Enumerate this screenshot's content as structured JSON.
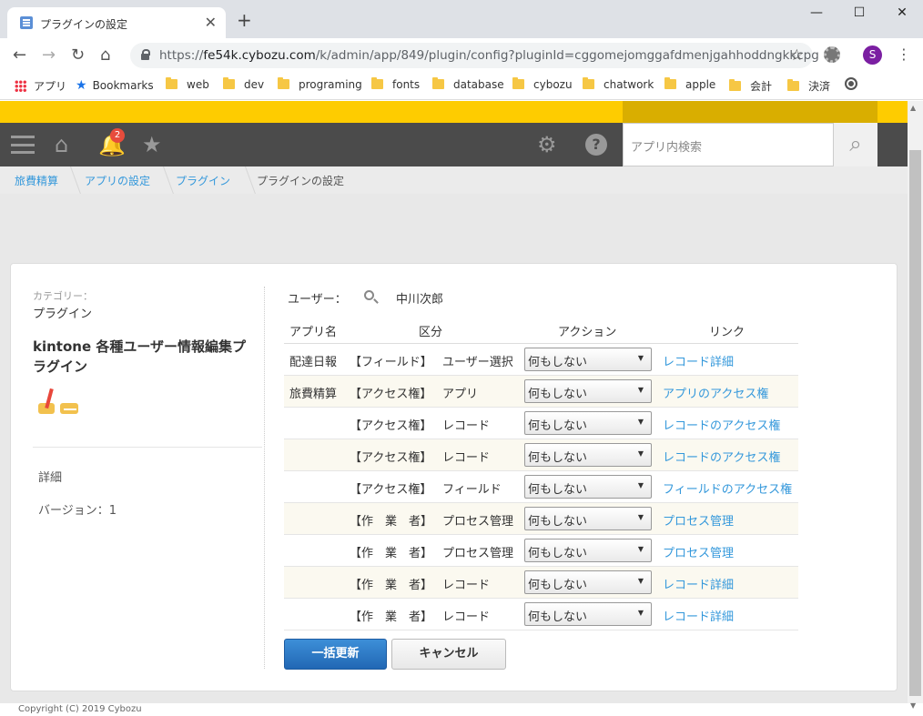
{
  "browser": {
    "tab_title": "プラグインの設定",
    "url_prefix": "https://",
    "url_host": "fe54k.cybozu.com",
    "url_path": "/k/admin/app/849/plugin/config?pluginId=cggomejomggafdmenjgahhoddngkkcpg",
    "profile_initial": "S",
    "bookmarks": [
      "アプリ",
      "Bookmarks",
      "web",
      "dev",
      "programing",
      "fonts",
      "database",
      "cybozu",
      "chatwork",
      "apple",
      "会計",
      "決済"
    ]
  },
  "header": {
    "notification_count": "2",
    "search_placeholder": "アプリ内検索"
  },
  "breadcrumb": [
    "旅費精算",
    "アプリの設定",
    "プラグイン",
    "プラグインの設定"
  ],
  "sidebar": {
    "category_label": "カテゴリー：",
    "category_value": "プラグイン",
    "plugin_title": "kintone 各種ユーザー情報編集プラグイン",
    "details_link": "詳細",
    "version": "バージョン：1"
  },
  "user": {
    "label": "ユーザー：",
    "name": "中川次郎"
  },
  "table": {
    "headers": [
      "アプリ名",
      "区分",
      "アクション",
      "リンク"
    ],
    "rows": [
      {
        "app": "配達日報",
        "category": "【フィールド】",
        "target": "ユーザー選択",
        "action": "何もしない",
        "link": "レコード詳細"
      },
      {
        "app": "旅費精算",
        "category": "【アクセス権】",
        "target": "アプリ",
        "action": "何もしない",
        "link": "アプリのアクセス権"
      },
      {
        "app": "",
        "category": "【アクセス権】",
        "target": "レコード",
        "action": "何もしない",
        "link": "レコードのアクセス権"
      },
      {
        "app": "",
        "category": "【アクセス権】",
        "target": "レコード",
        "action": "何もしない",
        "link": "レコードのアクセス権"
      },
      {
        "app": "",
        "category": "【アクセス権】",
        "target": "フィールド",
        "action": "何もしない",
        "link": "フィールドのアクセス権"
      },
      {
        "app": "",
        "category": "【作　業　者】",
        "target": "プロセス管理",
        "action": "何もしない",
        "link": "プロセス管理"
      },
      {
        "app": "",
        "category": "【作　業　者】",
        "target": "プロセス管理",
        "action": "何もしない",
        "link": "プロセス管理"
      },
      {
        "app": "",
        "category": "【作　業　者】",
        "target": "レコード",
        "action": "何もしない",
        "link": "レコード詳細"
      },
      {
        "app": "",
        "category": "【作　業　者】",
        "target": "レコード",
        "action": "何もしない",
        "link": "レコード詳細"
      }
    ]
  },
  "buttons": {
    "update": "一括更新",
    "cancel": "キャンセル"
  },
  "footer": "Copyright (C) 2019 Cybozu"
}
